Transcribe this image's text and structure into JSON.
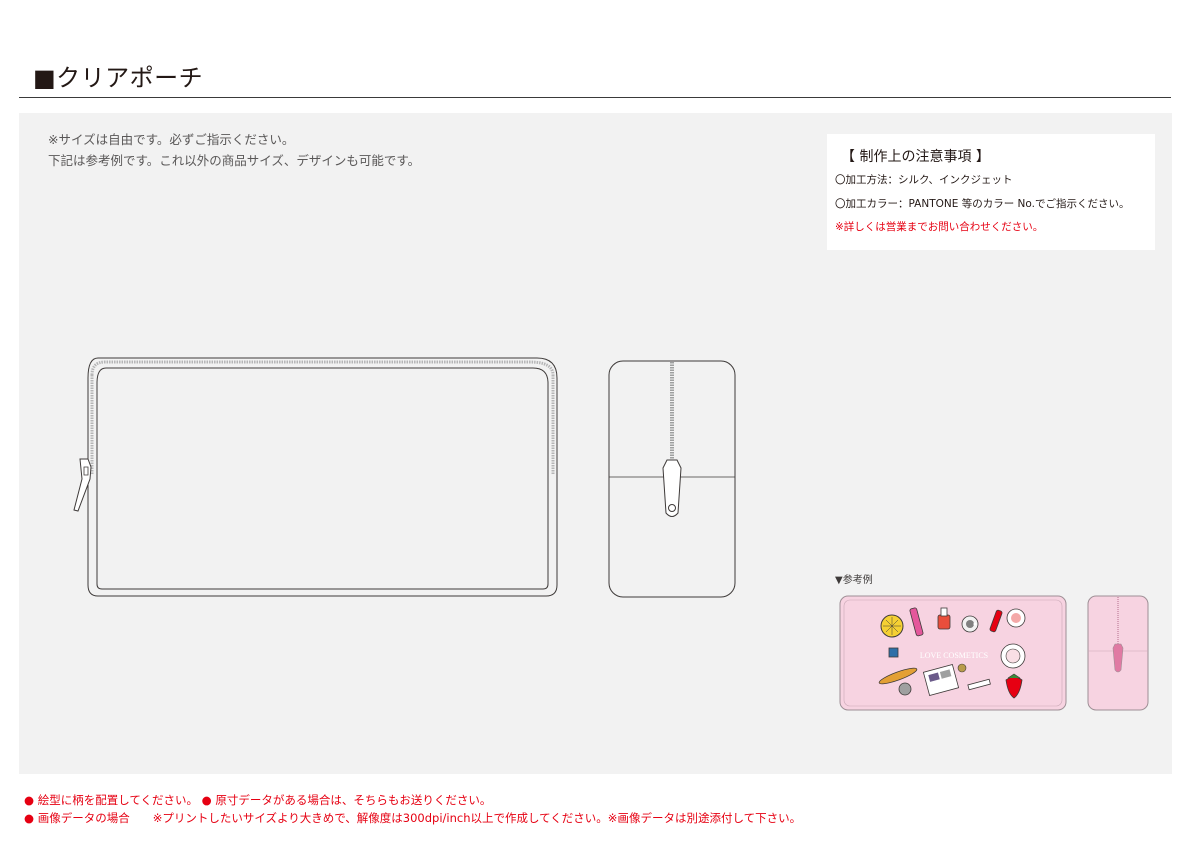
{
  "header": {
    "title": "■クリアポーチ"
  },
  "intro": {
    "line1": "※サイズは自由です。必ずご指示ください。",
    "line2": "下記は参考例です。これ以外の商品サイズ、デザインも可能です。"
  },
  "notes": {
    "title": "【 制作上の注意事項 】",
    "line1": "〇加工方法：シルク、インクジェット",
    "line2": "〇加工カラー：PANTONE 等のカラー No.でご指示ください。",
    "line3": "※詳しくは営業までお問い合わせください。"
  },
  "reference": {
    "label": "▼参考例",
    "print_text": "LOVE COSMETICS"
  },
  "footer": {
    "line1": "● 絵型に柄を配置してください。 ● 原寸データがある場合は、そちらもお送りください。",
    "line2": "● 画像データの場合　　※プリントしたいサイズより大きめで、解像度は300dpi/inch以上で作成してください。※画像データは別途添付して下さい。"
  },
  "colors": {
    "accent_red": "#e60012",
    "panel_bg": "#f2f2f2",
    "sample_pink": "#f7d3e1"
  }
}
